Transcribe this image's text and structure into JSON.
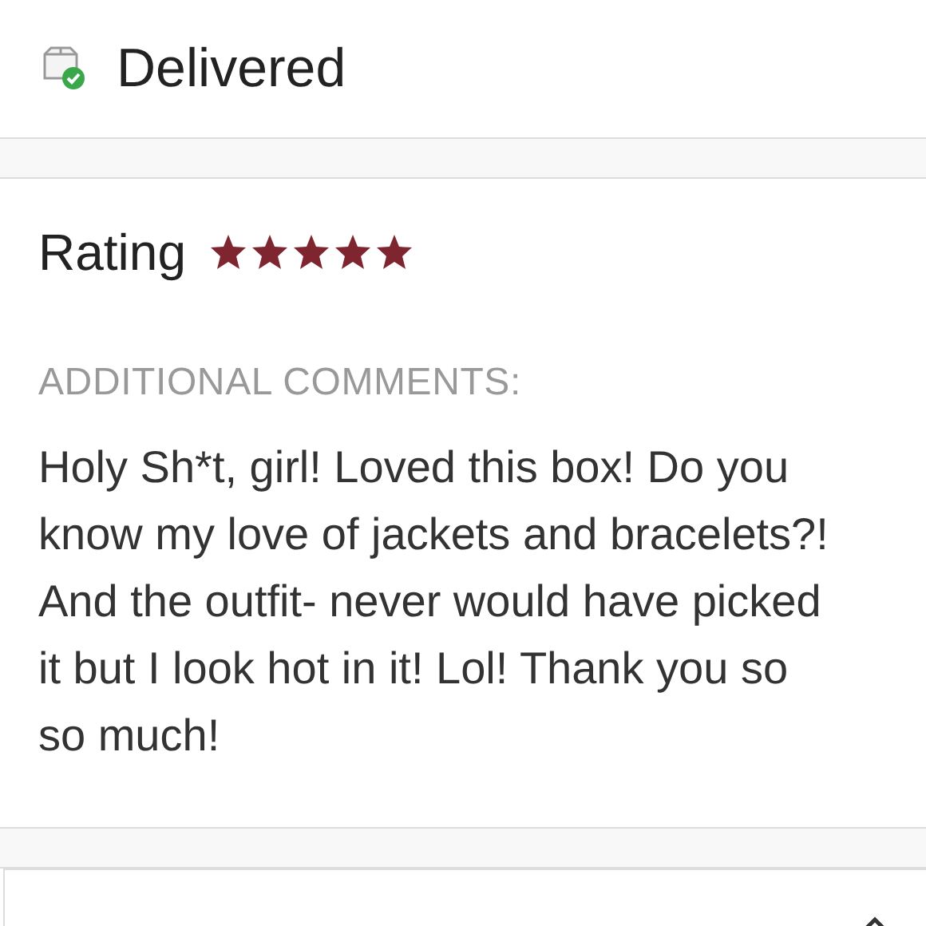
{
  "status": {
    "label": "Delivered"
  },
  "rating": {
    "label": "Rating",
    "stars": 5
  },
  "comments": {
    "heading": "ADDITIONAL COMMENTS:",
    "text": "Holy Sh*t, girl! Loved this box! Do you know my love of jackets and bracelets?! And the outfit- never would have picked it but I look hot in it! Lol! Thank you so so much!"
  }
}
